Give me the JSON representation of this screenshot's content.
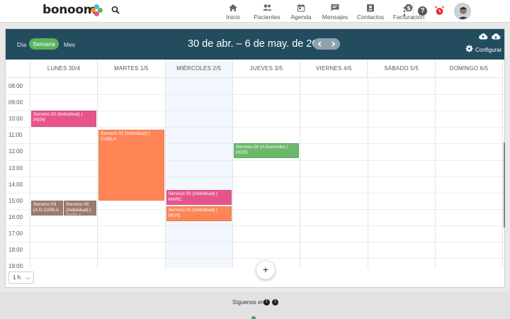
{
  "app": {
    "brand": "bonoom"
  },
  "nav": {
    "items": [
      {
        "label": "Inicio",
        "icon": "home-icon"
      },
      {
        "label": "Pacientes",
        "icon": "patients-icon"
      },
      {
        "label": "Agenda",
        "icon": "calendar-icon"
      },
      {
        "label": "Mensajes",
        "icon": "message-icon"
      },
      {
        "label": "Contactos",
        "icon": "contacts-icon"
      },
      {
        "label": "Facturación",
        "icon": "billing-icon"
      }
    ]
  },
  "calendar": {
    "views": {
      "day": "Día",
      "week": "Semana",
      "month": "Mes"
    },
    "range": "30 de abr. – 6 de may. de 2018",
    "configure": "Configurar",
    "days": [
      "LUNES 30/4",
      "MARTES 1/5",
      "MIÉRCOLES 2/5",
      "JUEVES 3/5",
      "VIERNES 4/5",
      "SÁBADO 5/5",
      "DOMINGO 6/5"
    ],
    "today_index": 2,
    "hours": [
      "08:00",
      "09:00",
      "10:00",
      "11:00",
      "12:00",
      "13:00",
      "14:00",
      "15:00",
      "16:00",
      "17:00",
      "18:00",
      "19:00"
    ],
    "first_hour": 8,
    "events": [
      {
        "text": "Servicio 02 (Individual) | PEPE",
        "day": 0,
        "start": 10.0,
        "end": 11.0,
        "color": "#e8548a"
      },
      {
        "text": "Servicio 01 (Individual) | CARLA",
        "day": 1,
        "start": 11.17,
        "end": 15.5,
        "color": "#ff8556"
      },
      {
        "text": "Servicio 04 (A Domicilio) | PEPE",
        "day": 3,
        "start": 12.0,
        "end": 12.9,
        "color": "#6bb86b"
      },
      {
        "text": "Servicio 02 (Individual) | MARC",
        "day": 2,
        "start": 14.83,
        "end": 15.75,
        "color": "#e8548a"
      },
      {
        "text": "Servicio 01 (Individual) | PEPE",
        "day": 2,
        "start": 15.83,
        "end": 16.75,
        "color": "#ff8556"
      },
      {
        "text": "Servicio 03 (A D CARLA",
        "day": 0,
        "start": 15.5,
        "end": 16.4,
        "color": "#9c7b6e",
        "half": "left"
      },
      {
        "text": "Servicio 03 (Individual) | CARLA",
        "day": 0,
        "start": 15.5,
        "end": 16.4,
        "color": "#9c7b6e",
        "half": "right"
      }
    ],
    "duration": "1 h",
    "add": "+"
  },
  "footer": {
    "text": "Síguenos en"
  },
  "colors": {
    "header": "#234c5f",
    "accent": "#5ab55f"
  }
}
